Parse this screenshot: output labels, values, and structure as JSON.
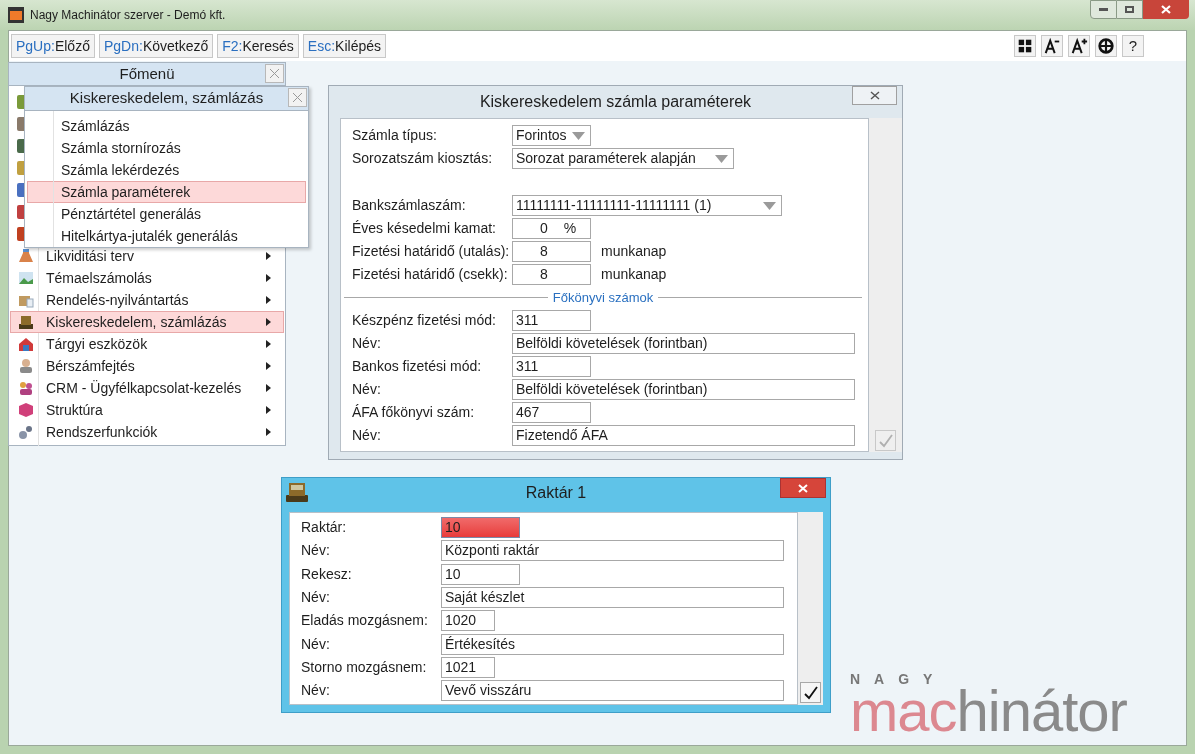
{
  "window": {
    "title": "Nagy Machinátor szerver - Demó kft."
  },
  "toolbar": {
    "shortcuts": [
      {
        "key": "PgUp:",
        "label": "Előző"
      },
      {
        "key": "PgDn:",
        "label": "Következő"
      },
      {
        "key": "F2:",
        "label": "Keresés"
      },
      {
        "key": "Esc:",
        "label": "Kilépés"
      }
    ],
    "tools": [
      {
        "kind": "grid"
      },
      {
        "kind": "font-smaller"
      },
      {
        "kind": "font-larger"
      },
      {
        "kind": "lifebuoy"
      },
      {
        "kind": "help",
        "label": "?"
      }
    ]
  },
  "main_menu": {
    "title": "Főmenü",
    "items": [
      {
        "label": "Likviditási terv",
        "selected": false
      },
      {
        "label": "Témaelszámolás",
        "selected": false
      },
      {
        "label": "Rendelés-nyilvántartás",
        "selected": false
      },
      {
        "label": "Kiskereskedelem, számlázás",
        "selected": true
      },
      {
        "label": "Tárgyi eszközök",
        "selected": false
      },
      {
        "label": "Bérszámfejtés",
        "selected": false
      },
      {
        "label": "CRM - Ügyfélkapcsolat-kezelés",
        "selected": false
      },
      {
        "label": "Struktúra",
        "selected": false
      },
      {
        "label": "Rendszerfunkciók",
        "selected": false
      }
    ]
  },
  "submenu": {
    "title": "Kiskereskedelem, számlázás",
    "items": [
      {
        "label": "Számlázás",
        "selected": false
      },
      {
        "label": "Számla stornírozás",
        "selected": false
      },
      {
        "label": "Számla lekérdezés",
        "selected": false
      },
      {
        "label": "Számla paraméterek",
        "selected": true
      },
      {
        "label": "Pénztártétel generálás",
        "selected": false
      },
      {
        "label": "Hitelkártya-jutalék generálás",
        "selected": false
      }
    ]
  },
  "params_dialog": {
    "title": "Kiskereskedelem számla paraméterek",
    "confirm_disabled": true,
    "groups": [
      {
        "rows": [
          {
            "kind": "select",
            "label": "Számla típus:",
            "value": "Forintos"
          },
          {
            "kind": "select",
            "label": "Sorozatszám kiosztás:",
            "value": "Sorozat paraméterek alapján"
          }
        ]
      },
      {
        "rows": [
          {
            "kind": "select",
            "label": "Bankszámlaszám:",
            "value": "11111111-11111111-11111111 (1)"
          },
          {
            "kind": "input",
            "label": "Éves késedelmi kamat:",
            "value": "0",
            "inner_unit": "%"
          },
          {
            "kind": "input",
            "label": "Fizetési határidő (utalás):",
            "value": "8",
            "unit": "munkanap"
          },
          {
            "kind": "input",
            "label": "Fizetési határidő (csekk):",
            "value": "8",
            "unit": "munkanap"
          }
        ]
      },
      {
        "title": "Főkönyvi számok",
        "rows": [
          {
            "kind": "input",
            "label": "Készpénz fizetési mód:",
            "value": "311"
          },
          {
            "kind": "input",
            "label": "Név:",
            "value": "Belföldi követelések (forintban)"
          },
          {
            "kind": "input",
            "label": "Bankos fizetési mód:",
            "value": "311"
          },
          {
            "kind": "input",
            "label": "Név:",
            "value": "Belföldi követelések (forintban)"
          },
          {
            "kind": "input",
            "label": "ÁFA főkönyvi szám:",
            "value": "467"
          },
          {
            "kind": "input",
            "label": "Név:",
            "value": "Fizetendő ÁFA"
          }
        ]
      }
    ]
  },
  "store_dialog": {
    "title": "Raktár 1",
    "confirm_disabled": false,
    "rows": [
      {
        "label": "Raktár:",
        "value": "10",
        "error": true
      },
      {
        "label": "Név:",
        "value": "Központi raktár",
        "error": false
      },
      {
        "label": "Rekesz:",
        "value": "10",
        "error": false
      },
      {
        "label": "Név:",
        "value": "Saját készlet",
        "error": false
      },
      {
        "label": "Eladás mozgásnem:",
        "value": "1020",
        "error": false
      },
      {
        "label": "Név:",
        "value": "Értékesítés",
        "error": false
      },
      {
        "label": "Storno mozgásnem:",
        "value": "1021",
        "error": false
      },
      {
        "label": "Név:",
        "value": "Vevő visszáru",
        "error": false
      }
    ]
  },
  "logo": {
    "top": "NAGY",
    "accent": "mac",
    "rest": "hinátor"
  }
}
